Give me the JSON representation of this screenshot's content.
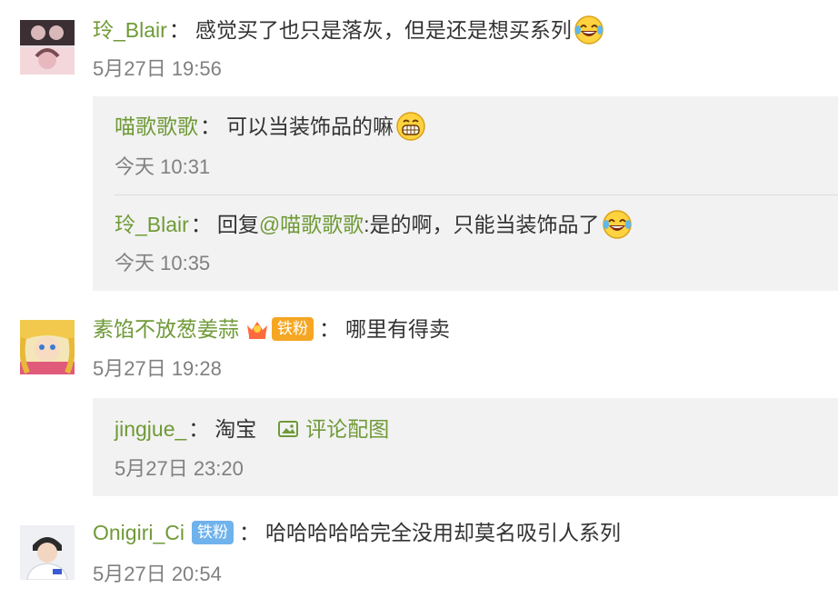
{
  "comments": [
    {
      "user": "玲_Blair",
      "text": "感觉买了也只是落灰，但是还是想买系列",
      "emoji": "laugh-cry-emoji",
      "time": "5月27日 19:56",
      "replies": [
        {
          "user": "喵歌歌歌",
          "text": "可以当装饰品的嘛",
          "emoji": "grin-emoji",
          "time": "今天 10:31"
        },
        {
          "user": "玲_Blair",
          "reply_prefix": "回复",
          "mention": "@喵歌歌歌",
          "text": ":是的啊，只能当装饰品了",
          "emoji": "laugh-cry-emoji",
          "time": "今天 10:35"
        }
      ]
    },
    {
      "user": "素馅不放葱姜蒜",
      "badge": "铁粉",
      "badge_color": "#f5a623",
      "text": "哪里有得卖",
      "time": "5月27日 19:28",
      "replies": [
        {
          "user": "jingjue_",
          "text": "淘宝",
          "image_link": "评论配图",
          "time": "5月27日 23:20"
        }
      ]
    },
    {
      "user": "Onigiri_Ci",
      "badge": "铁粉",
      "badge_color": "#6fb2ec",
      "text": "哈哈哈哈哈完全没用却莫名吸引人系列",
      "time": "5月27日 20:54"
    }
  ],
  "colors": {
    "username": "#6f9a37",
    "timestamp": "#808080",
    "reply_bg": "#f2f2f2"
  }
}
